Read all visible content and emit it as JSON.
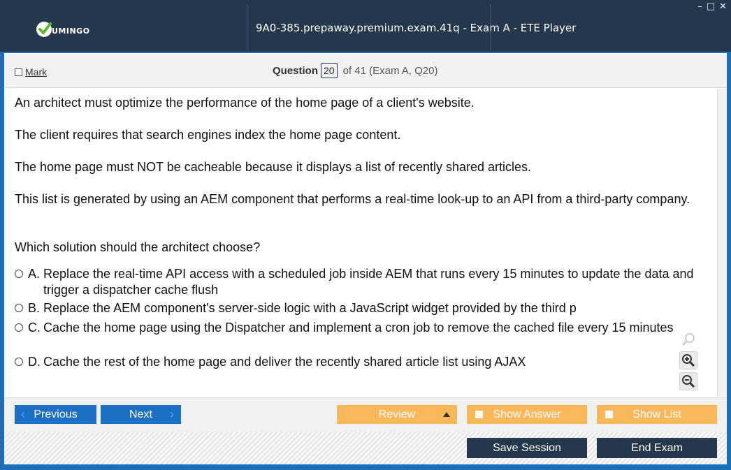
{
  "app": {
    "logo_text": "UMINGO",
    "window_title": "9A0-385.prepaway.premium.exam.41q - Exam A - ETE Player",
    "controls": {
      "minimize": "–",
      "maximize": "□",
      "close": "✕"
    }
  },
  "header": {
    "mark_label": "Mark",
    "question_word": "Question",
    "question_number": "20",
    "question_of": "of 41 (Exam A, Q20)"
  },
  "question": {
    "paragraphs": [
      "An architect must optimize the performance of the home page of a client's website.",
      "The client requires that search engines index the home page content.",
      "The home page must NOT be cacheable because it displays a list of recently shared articles.",
      "This list is generated by using an AEM component that performs a real-time look-up to an API from a third-party company.",
      "Which solution should the architect choose?"
    ],
    "options": [
      {
        "letter": "A.",
        "text": "Replace the real-time API access with a scheduled job inside AEM that runs every 15 minutes to update the data and trigger a dispatcher cache flush"
      },
      {
        "letter": "B.",
        "text": "Replace the AEM component's server-side logic with a JavaScript widget provided by the third p"
      },
      {
        "letter": "C.",
        "text": "Cache the home page using the Dispatcher and implement a cron job to remove the cached file every 15 minutes"
      },
      {
        "letter": "D.",
        "text": "Cache the rest of the home page and deliver the recently shared article list using AJAX"
      }
    ]
  },
  "zoom_icons": [
    "search-icon",
    "zoom-in-icon",
    "zoom-out-icon"
  ],
  "footer": {
    "previous": "Previous",
    "next": "Next",
    "review": "Review",
    "show_answer": "Show Answer",
    "show_list": "Show List",
    "save_session": "Save Session",
    "end_exam": "End Exam"
  },
  "colors": {
    "titlebar": "#25374c",
    "accent_blue": "#1d6fc4",
    "orange": "#fbb85a",
    "logo_green": "#5cb82e"
  }
}
